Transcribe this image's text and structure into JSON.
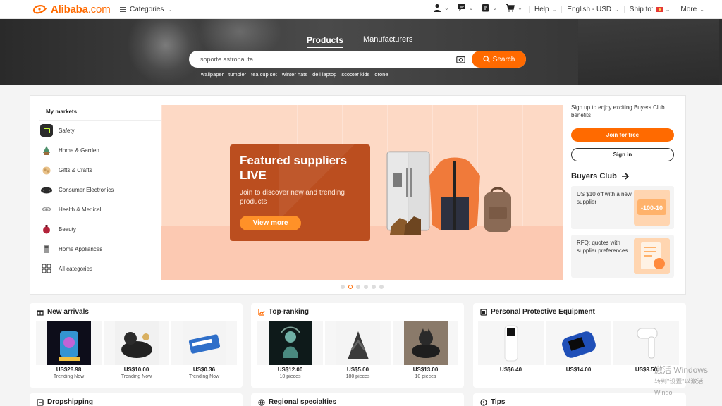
{
  "header": {
    "logo_text": "Alibaba",
    "logo_domain": ".com",
    "categories_label": "Categories",
    "help_label": "Help",
    "language_label": "English - USD",
    "ship_to_label": "Ship to:",
    "more_label": "More"
  },
  "hero": {
    "tab_products": "Products",
    "tab_manufacturers": "Manufacturers",
    "search_value": "soporte astronauta",
    "search_button": "Search",
    "hot_searches": [
      "wallpaper",
      "tumbler",
      "tea cup set",
      "winter hats",
      "dell laptop",
      "scooter kids",
      "drone"
    ]
  },
  "markets": {
    "title": "My markets",
    "items": [
      {
        "label": "Safety",
        "icon": "safety-icon",
        "color": "#333333"
      },
      {
        "label": "Home & Garden",
        "icon": "home-garden-icon",
        "color": "#4c8f6a"
      },
      {
        "label": "Gifts & Crafts",
        "icon": "gifts-crafts-icon",
        "color": "#c89b5c"
      },
      {
        "label": "Consumer Electronics",
        "icon": "electronics-icon",
        "color": "#2b2b2b"
      },
      {
        "label": "Health & Medical",
        "icon": "health-medical-icon",
        "color": "#8a8a8a"
      },
      {
        "label": "Beauty",
        "icon": "beauty-icon",
        "color": "#b3233a"
      },
      {
        "label": "Home Appliances",
        "icon": "home-appliances-icon",
        "color": "#777777"
      },
      {
        "label": "All categories",
        "icon": "all-categories-icon",
        "color": "#555555"
      }
    ]
  },
  "banner": {
    "title": "Featured suppliers LIVE",
    "subtitle": "Join to discover new and trending products",
    "button": "View more",
    "slide_count": 6,
    "active_slide": 2
  },
  "side": {
    "signup_text": "Sign up to enjoy exciting Buyers Club benefits",
    "join_button": "Join for free",
    "signin_button": "Sign in",
    "club_title": "Buyers Club",
    "card1_text": "US $10 off with a new supplier",
    "card2_text": "RFQ: quotes with supplier preferences"
  },
  "cards": [
    {
      "title": "New arrivals",
      "icon": "gift-icon",
      "products": [
        {
          "price": "US$28.98",
          "sub": "Trending Now"
        },
        {
          "price": "US$10.00",
          "sub": "Trending Now"
        },
        {
          "price": "US$0.36",
          "sub": "Trending Now"
        }
      ]
    },
    {
      "title": "Top-ranking",
      "icon": "ranking-icon",
      "products": [
        {
          "price": "US$12.00",
          "sub": "10 pieces"
        },
        {
          "price": "US$5.00",
          "sub": "180 pieces"
        },
        {
          "price": "US$13.00",
          "sub": "10 pieces"
        }
      ]
    },
    {
      "title": "Personal Protective Equipment",
      "icon": "ppe-icon",
      "products": [
        {
          "price": "US$6.40",
          "sub": ""
        },
        {
          "price": "US$14.00",
          "sub": ""
        },
        {
          "price": "US$9.50",
          "sub": ""
        }
      ]
    }
  ],
  "cards_row2": [
    {
      "title": "Dropshipping",
      "icon": "dropshipping-icon"
    },
    {
      "title": "Regional specialties",
      "icon": "globe-icon"
    },
    {
      "title": "Tips",
      "icon": "tips-icon"
    }
  ],
  "watermark": {
    "line1": "激活 Windows",
    "line2": "转到\"设置\"以激活 Windo"
  },
  "colors": {
    "brand": "#ff6a00",
    "banner_bg": "#fdd9c5",
    "live_card": "#bb4e1f"
  }
}
